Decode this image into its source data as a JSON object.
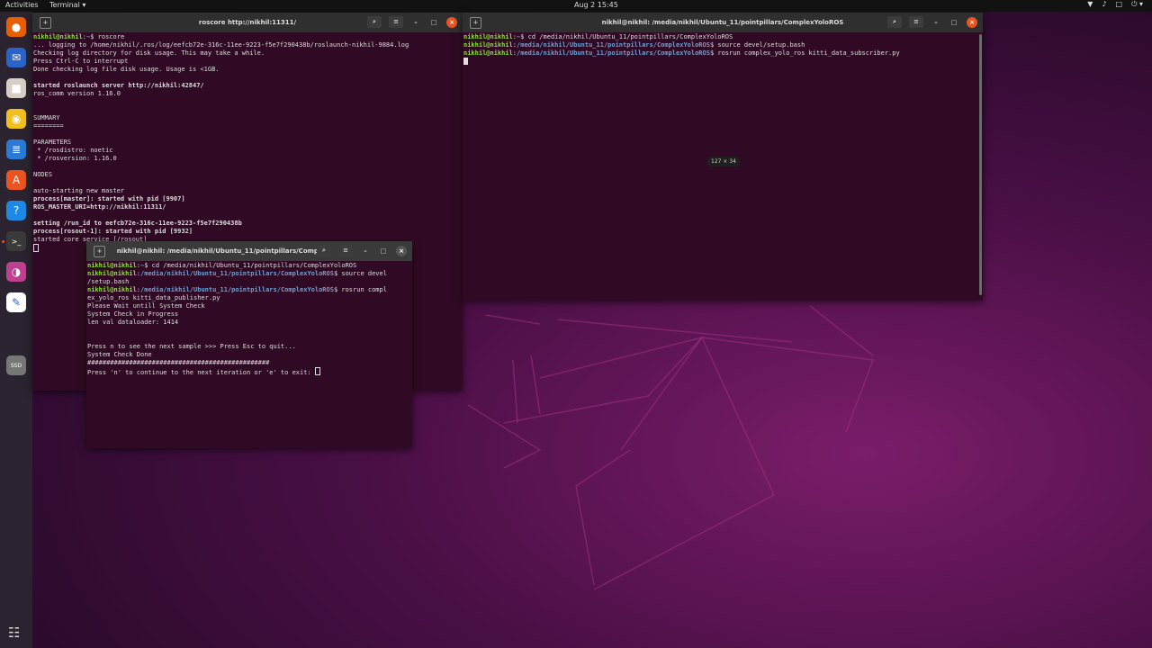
{
  "topbar": {
    "activities": "Activities",
    "app_menu": "Terminal ▾",
    "clock": "Aug 2  15:45",
    "tray": [
      "▼",
      "♪",
      "□",
      "⏻ ▾"
    ]
  },
  "dock": {
    "items": [
      {
        "name": "firefox-icon",
        "glyph": "●",
        "bg": "#e66000"
      },
      {
        "name": "thunderbird-icon",
        "glyph": "✉",
        "bg": "#2a64c9"
      },
      {
        "name": "files-icon",
        "glyph": "■",
        "bg": "#d7cfc4"
      },
      {
        "name": "rhythmbox-icon",
        "glyph": "◉",
        "bg": "#f0c020"
      },
      {
        "name": "writer-icon",
        "glyph": "≣",
        "bg": "#2a7ad6"
      },
      {
        "name": "software-icon",
        "glyph": "A",
        "bg": "#e95420"
      },
      {
        "name": "help-icon",
        "glyph": "?",
        "bg": "#1e88e5"
      },
      {
        "name": "terminal-icon",
        "glyph": ">_",
        "bg": "#3a3a3a"
      },
      {
        "name": "color-picker-icon",
        "glyph": "◑",
        "bg": "#c04090"
      },
      {
        "name": "text-editor-icon",
        "glyph": "✎",
        "bg": "#ffffff"
      },
      {
        "name": "ssd-drive-icon",
        "glyph": "SSD",
        "bg": "#777777"
      }
    ],
    "show_apps": "☷"
  },
  "win_roscore": {
    "title": "roscore http://nikhil:11311/",
    "lines": [
      {
        "u": "nikhil@nikhil",
        "p": "~",
        "cmd": "$ roscore"
      },
      {
        "t": "... logging to /home/nikhil/.ros/log/eefcb72e-316c-11ee-9223-f5e7f290438b/roslaunch-nikhil-9884.log"
      },
      {
        "t": "Checking log directory for disk usage. This may take a while."
      },
      {
        "t": "Press Ctrl-C to interrupt"
      },
      {
        "t": "Done checking log file disk usage. Usage is <1GB."
      },
      {
        "t": ""
      },
      {
        "t": "started roslaunch server http://nikhil:42847/",
        "b": true
      },
      {
        "t": "ros_comm version 1.16.0"
      },
      {
        "t": ""
      },
      {
        "t": ""
      },
      {
        "t": "SUMMARY"
      },
      {
        "t": "========"
      },
      {
        "t": ""
      },
      {
        "t": "PARAMETERS"
      },
      {
        "t": " * /rosdistro: noetic"
      },
      {
        "t": " * /rosversion: 1.16.0"
      },
      {
        "t": ""
      },
      {
        "t": "NODES"
      },
      {
        "t": ""
      },
      {
        "t": "auto-starting new master"
      },
      {
        "t": "process[master]: started with pid [9907]",
        "b": true
      },
      {
        "t": "ROS_MASTER_URI=http://nikhil:11311/",
        "b": true
      },
      {
        "t": ""
      },
      {
        "t": "setting /run_id to eefcb72e-316c-11ee-9223-f5e7f290438b",
        "b": true
      },
      {
        "t": "process[rosout-1]: started with pid [9932]",
        "b": true
      },
      {
        "t": "started core service [/rosout]"
      }
    ]
  },
  "win_subscriber": {
    "title": "nikhil@nikhil: /media/nikhil/Ubuntu_11/pointpillars/ComplexYoloROS",
    "lines": [
      {
        "u": "nikhil@nikhil",
        "p": "~",
        "cmd": "$ cd /media/nikhil/Ubuntu_11/pointpillars/ComplexYoloROS"
      },
      {
        "u": "nikhil@nikhil",
        "p": "/media/nikhil/Ubuntu_11/pointpillars/ComplexYoloROS",
        "cmd": "$ source devel/setup.bash"
      },
      {
        "u": "nikhil@nikhil",
        "p": "/media/nikhil/Ubuntu_11/pointpillars/ComplexYoloROS",
        "cmd": "$ rosrun complex_yolo_ros kitti_data_subscriber.py"
      }
    ],
    "size_tooltip": "127 × 34"
  },
  "win_publisher": {
    "title": "nikhil@nikhil: /media/nikhil/Ubuntu_11/pointpillars/Compl...",
    "lines": [
      {
        "u": "nikhil@nikhil",
        "p": "~",
        "cmd": "$ cd /media/nikhil/Ubuntu_11/pointpillars/ComplexYoloROS"
      },
      {
        "u": "nikhil@nikhil",
        "p": "/media/nikhil/Ubuntu_11/pointpillars/ComplexYoloROS",
        "cmd": "$ source devel"
      },
      {
        "t": "/setup.bash"
      },
      {
        "u": "nikhil@nikhil",
        "p": "/media/nikhil/Ubuntu_11/pointpillars/ComplexYoloROS",
        "cmd": "$ rosrun compl"
      },
      {
        "t": "ex_yolo_ros kitti_data_publisher.py"
      },
      {
        "t": "Please Wait untill System Check"
      },
      {
        "t": "System Check in Progress"
      },
      {
        "t": "len val dataloader: 1414"
      },
      {
        "t": ""
      },
      {
        "t": ""
      },
      {
        "t": "Press n to see the next sample >>> Press Esc to quit..."
      },
      {
        "t": "System Check Done"
      },
      {
        "t": "################################################"
      },
      {
        "t": "Press 'n' to continue to the next iteration or 'e' to exit: "
      }
    ]
  }
}
